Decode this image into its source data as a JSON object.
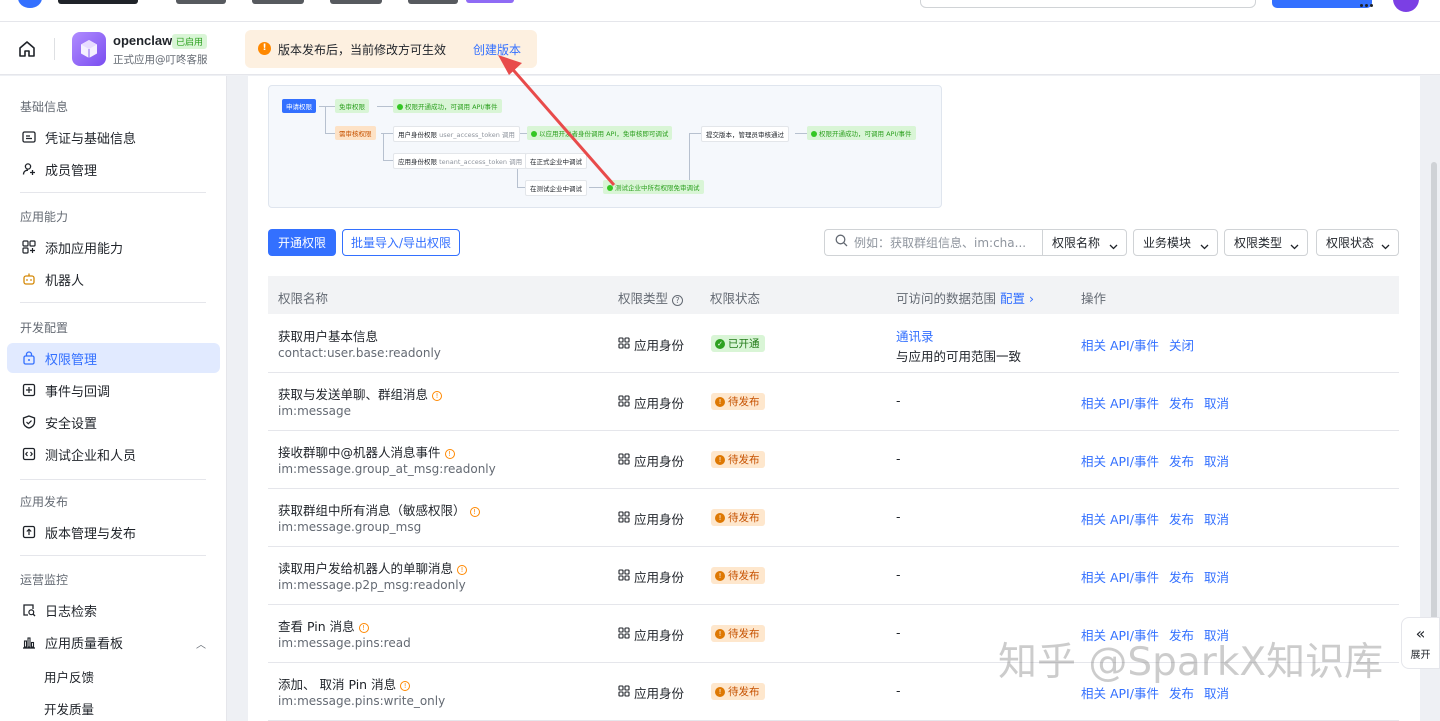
{
  "app": {
    "name": "openclaw",
    "status": "已启用",
    "subtitle": "正式应用@叮咚客服"
  },
  "notice": {
    "text": "版本发布后，当前修改方可生效",
    "link": "创建版本"
  },
  "sidebar": {
    "sections": [
      {
        "title": "基础信息",
        "items": [
          {
            "label": "凭证与基础信息",
            "icon": "id-card-icon"
          },
          {
            "label": "成员管理",
            "icon": "user-add-icon"
          }
        ]
      },
      {
        "title": "应用能力",
        "items": [
          {
            "label": "添加应用能力",
            "icon": "grid-add-icon"
          },
          {
            "label": "机器人",
            "icon": "robot-icon"
          }
        ]
      },
      {
        "title": "开发配置",
        "items": [
          {
            "label": "权限管理",
            "icon": "lock-icon",
            "active": true
          },
          {
            "label": "事件与回调",
            "icon": "event-icon"
          },
          {
            "label": "安全设置",
            "icon": "shield-icon"
          },
          {
            "label": "测试企业和人员",
            "icon": "code-icon"
          }
        ]
      },
      {
        "title": "应用发布",
        "items": [
          {
            "label": "版本管理与发布",
            "icon": "upload-icon"
          }
        ]
      },
      {
        "title": "运营监控",
        "items": [
          {
            "label": "日志检索",
            "icon": "log-search-icon"
          },
          {
            "label": "应用质量看板",
            "icon": "bar-chart-icon"
          }
        ],
        "subitems": [
          "用户反馈",
          "开发质量"
        ]
      }
    ]
  },
  "flow": {
    "apply": "申请权限",
    "free": "免审权限",
    "free_done": "权限开通成功，可调用 API/事件",
    "review": "需审核权限",
    "user_identity": "用户身份权限",
    "user_token": "user_access_token",
    "call": "调用",
    "user_done": "以应用开发者身份调用 API，免审核即可调试",
    "submit": "提交版本，管理员审核通过",
    "final_done": "权限开通成功，可调用 API/事件",
    "tenant_identity": "应用身份权限",
    "tenant_token": "tenant_access_token",
    "formal": "在正式企业中调试",
    "test": "在测试企业中调试",
    "test_done": "测试企业中所有权限免审调试"
  },
  "toolbar": {
    "open_btn": "开通权限",
    "batch_btn": "批量导入/导出权限",
    "search_placeholder": "例如：获取群组信息、im:cha...",
    "filter_name": "权限名称",
    "filter_module": "业务模块",
    "filter_type": "权限类型",
    "filter_status": "权限状态"
  },
  "table": {
    "headers": {
      "name": "权限名称",
      "type": "权限类型",
      "status": "权限状态",
      "scope": "可访问的数据范围",
      "scope_link": "配置",
      "ops": "操作"
    },
    "rows": [
      {
        "name": "获取用户基本信息",
        "code": "contact:user.base:readonly",
        "type": "应用身份",
        "status": "已开通",
        "scope_link": "通讯录",
        "scope_text": "与应用的可用范围一致",
        "ops": [
          "相关 API/事件",
          "关闭"
        ]
      },
      {
        "name": "获取与发送单聊、群组消息",
        "code": "im:message",
        "type": "应用身份",
        "status": "待发布",
        "scope": "-",
        "ops": [
          "相关 API/事件",
          "发布",
          "取消"
        ]
      },
      {
        "name": "接收群聊中@机器人消息事件",
        "code": "im:message.group_at_msg:readonly",
        "type": "应用身份",
        "status": "待发布",
        "scope": "-",
        "ops": [
          "相关 API/事件",
          "发布",
          "取消"
        ]
      },
      {
        "name": "获取群组中所有消息（敏感权限）",
        "code": "im:message.group_msg",
        "type": "应用身份",
        "status": "待发布",
        "scope": "-",
        "ops": [
          "相关 API/事件",
          "发布",
          "取消"
        ]
      },
      {
        "name": "读取用户发给机器人的单聊消息",
        "code": "im:message.p2p_msg:readonly",
        "type": "应用身份",
        "status": "待发布",
        "scope": "-",
        "ops": [
          "相关 API/事件",
          "发布",
          "取消"
        ]
      },
      {
        "name": "查看 Pin 消息",
        "code": "im:message.pins:read",
        "type": "应用身份",
        "status": "待发布",
        "scope": "-",
        "ops": [
          "相关 API/事件",
          "发布",
          "取消"
        ]
      },
      {
        "name": "添加、 取消 Pin 消息",
        "code": "im:message.pins:write_only",
        "type": "应用身份",
        "status": "待发布",
        "scope": "-",
        "ops": [
          "相关 API/事件",
          "发布",
          "取消"
        ]
      }
    ]
  },
  "expand_label": "展开",
  "watermark": "知乎 @SparkX知识库",
  "colors": {
    "primary": "#3370ff",
    "success": "#2ea121",
    "warning": "#ff8800",
    "annotation_arrow": "#e84b4b"
  }
}
